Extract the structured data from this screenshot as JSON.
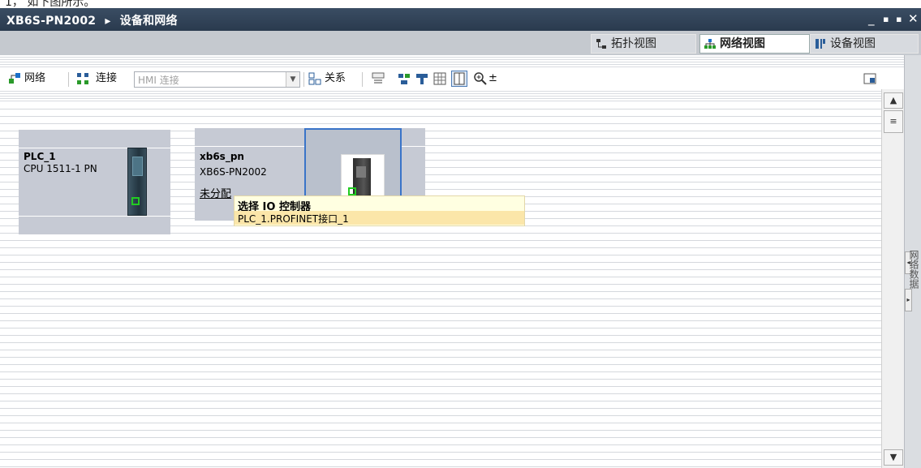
{
  "top_strip_text": "1，   如下图所示。",
  "title": {
    "device": "XB6S-PN2002",
    "section": "设备和网络",
    "arrow": "▸",
    "minimize": "_",
    "restore": "▪",
    "maximize": "▪",
    "close": "✕"
  },
  "views": {
    "topology": "拓扑视图",
    "network": "网络视图",
    "device": "设备视图",
    "active": "网络视图"
  },
  "toolbar": {
    "network": "网络",
    "connection": "连接",
    "hmi_connection": "HMI 连接",
    "relation": "关系",
    "zoom_glyph": "±"
  },
  "devices": [
    {
      "name": "PLC_1",
      "model": "CPU 1511-1 PN"
    },
    {
      "name": "xb6s_pn",
      "model": "XB6S-PN2002",
      "status_link": "未分配"
    }
  ],
  "tooltip": {
    "header": "选择 IO 控制器",
    "option": "PLC_1.PROFINET接口_1"
  },
  "sidebar_label": "网络数据",
  "colors": {
    "title_bar": "#2f4157",
    "selection": "#3a74c8",
    "tooltip_bg": "#ffffe1",
    "tooltip_hover": "#fbe6a9",
    "link": "#1a3cff",
    "port_green": "#22cc22"
  }
}
